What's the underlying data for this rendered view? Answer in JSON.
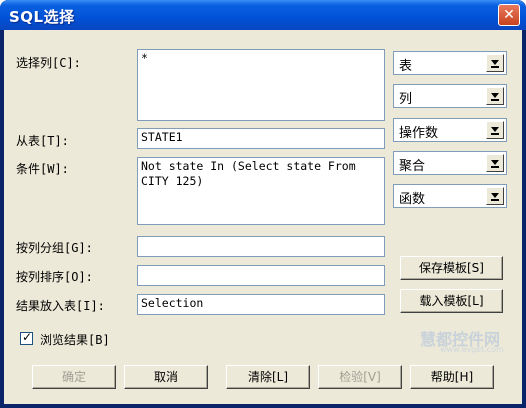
{
  "window": {
    "title": "SQL选择",
    "close_glyph": "✕"
  },
  "labels": {
    "select_columns": "选择列[C]:",
    "from_table": "从表[T]:",
    "condition": "条件[W]:",
    "group_by": "按列分组[G]:",
    "order_by": "按列排序[O]:",
    "result_table": "结果放入表[I]:"
  },
  "fields": {
    "select_columns": "*",
    "from_table": "STATE1",
    "condition": "Not state In (Select state From CITY 125)",
    "group_by": "",
    "order_by": "",
    "result_table": "Selection"
  },
  "combos": [
    "表",
    "列",
    "操作数",
    "聚合",
    "函数"
  ],
  "side_buttons": {
    "save_template": "保存模板[S]",
    "load_template": "载入模板[L]"
  },
  "checkbox": {
    "label": "浏览结果[B]",
    "checked": true,
    "mark": "✓"
  },
  "bottom_buttons": {
    "ok": "确定",
    "cancel": "取消",
    "clear": "清除[L]",
    "verify": "检验[V]",
    "help": "帮助[H]"
  },
  "watermark": {
    "text": "慧都控件网",
    "sub": "www.evget.com"
  }
}
